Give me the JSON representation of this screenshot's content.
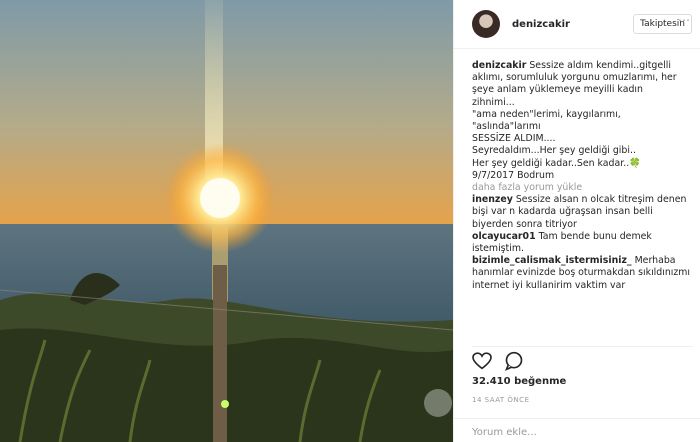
{
  "post": {
    "username": "denizcakir",
    "follow_label": "Takiptesin",
    "caption_user": "denizcakir",
    "caption_lines": [
      "Sessize aldım kendimi..gitgelli",
      "aklımı, sorumluluk yorgunu omuzlarımı, her",
      "şeye anlam yüklemeye meyilli kadın",
      "zihnimi...",
      "\"ama neden\"lerimi, kaygılarımı,",
      "\"aslında\"larımı",
      "SESSİZE ALDIM....",
      "Seyredaldım...Her şey geldiği gibi..",
      "Her şey geldiği kadar..Sen kadar..🍀",
      "9/7/2017 Bodrum"
    ],
    "load_more": "daha fazla yorum yükle",
    "comments": [
      {
        "user": "inenzey",
        "text": "Sessize alsan n olcak titreşim denen bişi var n kadarda uğraşsan insan belli biyerden sonra titriyor"
      },
      {
        "user": "olcayucar01",
        "text": "Tam bende bunu demek istemiştim."
      },
      {
        "user": "bizimle_calismak_istermisiniz_",
        "text": "Merhaba hanımlar evinizde boş oturmakdan sıkıldınızmı internet iyi kullanirim vaktim var"
      }
    ],
    "likes": "32.410 beğenme",
    "time": "14 SAAT ÖNCE",
    "add_comment_placeholder": "Yorum ekle...",
    "more_icon": "…"
  },
  "icons": {
    "like": "heart-icon",
    "comment": "comment-icon"
  }
}
